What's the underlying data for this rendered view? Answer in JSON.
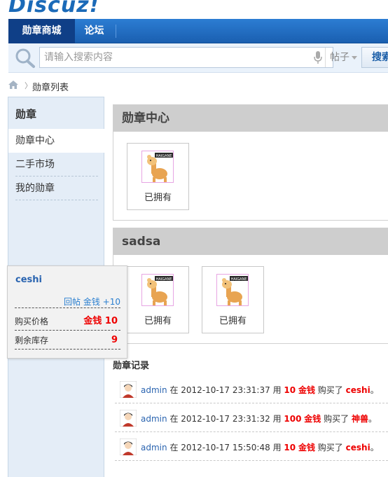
{
  "logo": "Discuz!",
  "nav": {
    "items": [
      {
        "label": "勋章商城"
      },
      {
        "label": "论坛"
      }
    ]
  },
  "search": {
    "placeholder": "请输入搜索内容",
    "type": "帖子",
    "button": "搜索"
  },
  "breadcrumb": {
    "label": "勋章列表"
  },
  "sidebar": {
    "title": "勋章",
    "items": [
      {
        "label": "勋章中心"
      },
      {
        "label": "二手市场"
      },
      {
        "label": "我的勋章"
      }
    ]
  },
  "sections": [
    {
      "title": "勋章中心",
      "medals": [
        {
          "label": "已拥有",
          "badge": "HAIGANE"
        }
      ]
    },
    {
      "title": "sadsa",
      "medals": [
        {
          "label": "已拥有",
          "badge": "HAIGANE"
        },
        {
          "label": "已拥有",
          "badge": "HAIGANE"
        }
      ]
    }
  ],
  "popup": {
    "name": "ceshi",
    "reward": "回帖  金钱 +10",
    "price_label": "购买价格",
    "price_value": "金钱 10",
    "stock_label": "剩余库存",
    "stock_value": "9"
  },
  "records": {
    "title": "勋章记录",
    "items": [
      {
        "user": "admin",
        "at": "在",
        "time": "2012-10-17 23:31:37",
        "use": "用",
        "amount": "10",
        "currency": "金钱",
        "bought": "购买了",
        "item": "ceshi",
        "end": "。"
      },
      {
        "user": "admin",
        "at": "在",
        "time": "2012-10-17 23:31:32",
        "use": "用",
        "amount": "100",
        "currency": "金钱",
        "bought": "购买了",
        "item": "神兽",
        "end": "。"
      },
      {
        "user": "admin",
        "at": "在",
        "time": "2012-10-17 15:50:48",
        "use": "用",
        "amount": "10",
        "currency": "金钱",
        "bought": "购买了",
        "item": "ceshi",
        "end": "。"
      }
    ]
  },
  "colors": {
    "nav": "#1a5fb0",
    "accent": "#e00000",
    "link": "#2a64b0"
  }
}
